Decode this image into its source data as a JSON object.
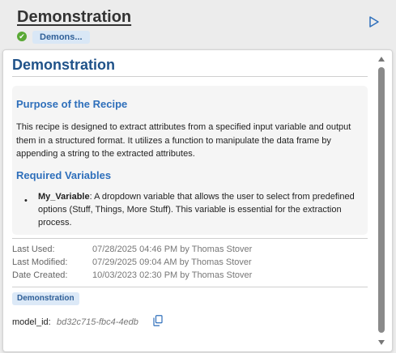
{
  "header": {
    "title": "Demonstration",
    "chip_label": "Demons...",
    "status_icon": "✔"
  },
  "card": {
    "title": "Demonstration",
    "purpose_heading": "Purpose of the Recipe",
    "purpose_text": "This recipe is designed to extract attributes from a specified input variable and output them in a structured format. It utilizes a function to manipulate the data frame by appending a string to the extracted attributes.",
    "variables_heading": "Required Variables",
    "variables": [
      {
        "name": "My_Variable",
        "description": ": A dropdown variable that allows the user to select from predefined options (Stuff, Things, More Stuff). This variable is essential for the extraction process."
      }
    ],
    "meta": {
      "last_used_label": "Last Used:",
      "last_used_value": "07/28/2025 04:46 PM by Thomas Stover",
      "last_modified_label": "Last Modified:",
      "last_modified_value": "07/29/2025 09:04 AM by Thomas Stover",
      "date_created_label": "Date Created:",
      "date_created_value": "10/03/2023 02:30 PM by Thomas Stover"
    },
    "tag_label": "Demonstration",
    "model_id_label": "model_id:",
    "model_id_value": "bd32c715-fbc4-4edb"
  },
  "colors": {
    "accent": "#2e6fbb",
    "title_blue": "#1f5289",
    "status_green": "#5aa936",
    "chip_bg": "#d9e7f6"
  },
  "icons": {
    "run": "play-icon",
    "status": "check-circle-icon",
    "copy": "copy-icon"
  }
}
